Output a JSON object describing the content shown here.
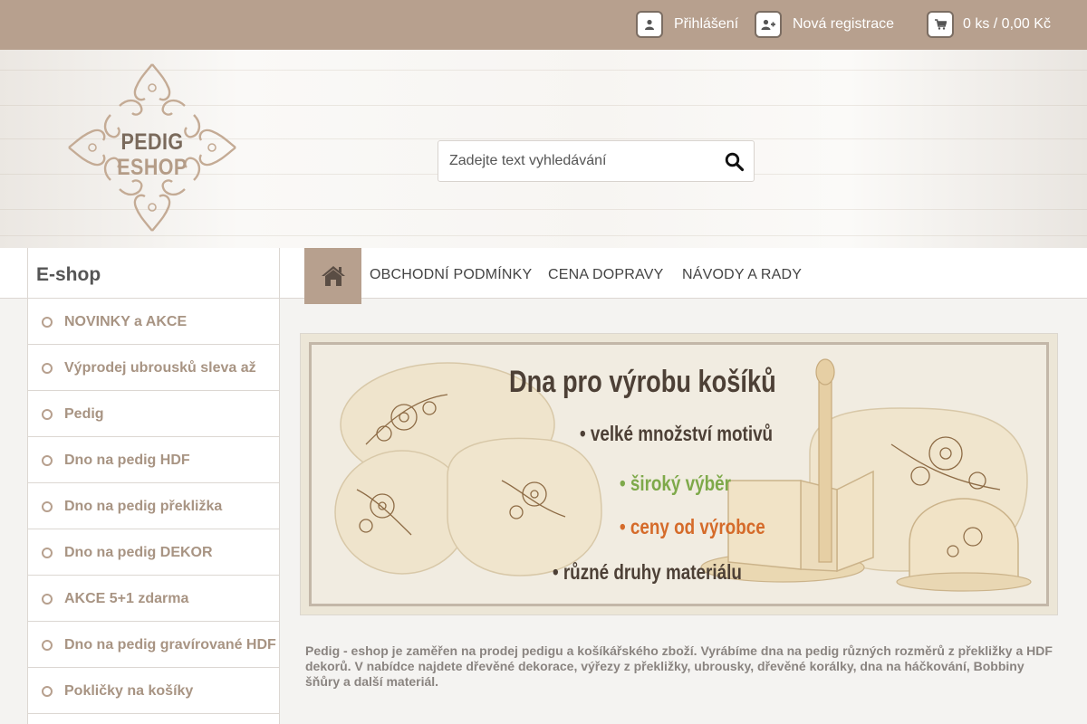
{
  "topbar": {
    "login_label": "Přihlášení",
    "register_label": "Nová registrace",
    "cart_label": "0 ks / 0,00 Kč",
    "icons": [
      "user-icon",
      "user-plus-icon",
      "cart-icon"
    ]
  },
  "header": {
    "logo": {
      "line1": "PEDIG",
      "line2": "ESHOP"
    },
    "search": {
      "placeholder": "Zadejte text vyhledávání"
    }
  },
  "nav": {
    "eshop_title": "E-shop",
    "home_icon": "home-icon",
    "links": [
      "OBCHODNÍ PODMÍNKY",
      "CENA DOPRAVY",
      "NÁVODY A RADY"
    ]
  },
  "sidebar": {
    "items": [
      "NOVINKY a AKCE",
      "Výprodej ubrousků sleva až",
      "Pedig",
      "Dno na pedig HDF",
      "Dno na pedig překližka",
      "Dno na pedig DEKOR",
      "AKCE 5+1 zdarma",
      "Dno na pedig gravírované HDF",
      "Pokličky na košíky"
    ]
  },
  "banner": {
    "title": "Dna pro výrobu košíků",
    "lines": [
      "• velké množství motivů",
      "• široký výběr",
      "• ceny od výrobce",
      "• různé druhy materiálu"
    ]
  },
  "description": "Pedig - eshop je zaměřen na prodej pedigu a košíkářského zboží. Vyrábíme dna na pedig různých rozměrů z překližky a HDF dekorů. V nabídce najdete dřevěné dekorace, výřezy z překližky, ubrousky, dřevěné korálky, dna na háčkování, Bobbiny šňůry  a další materiál.",
  "colors": {
    "accent": "#b7a08e",
    "sidebar_text": "#a89483",
    "banner_green": "#7ea94a",
    "banner_orange": "#d56b2a"
  }
}
